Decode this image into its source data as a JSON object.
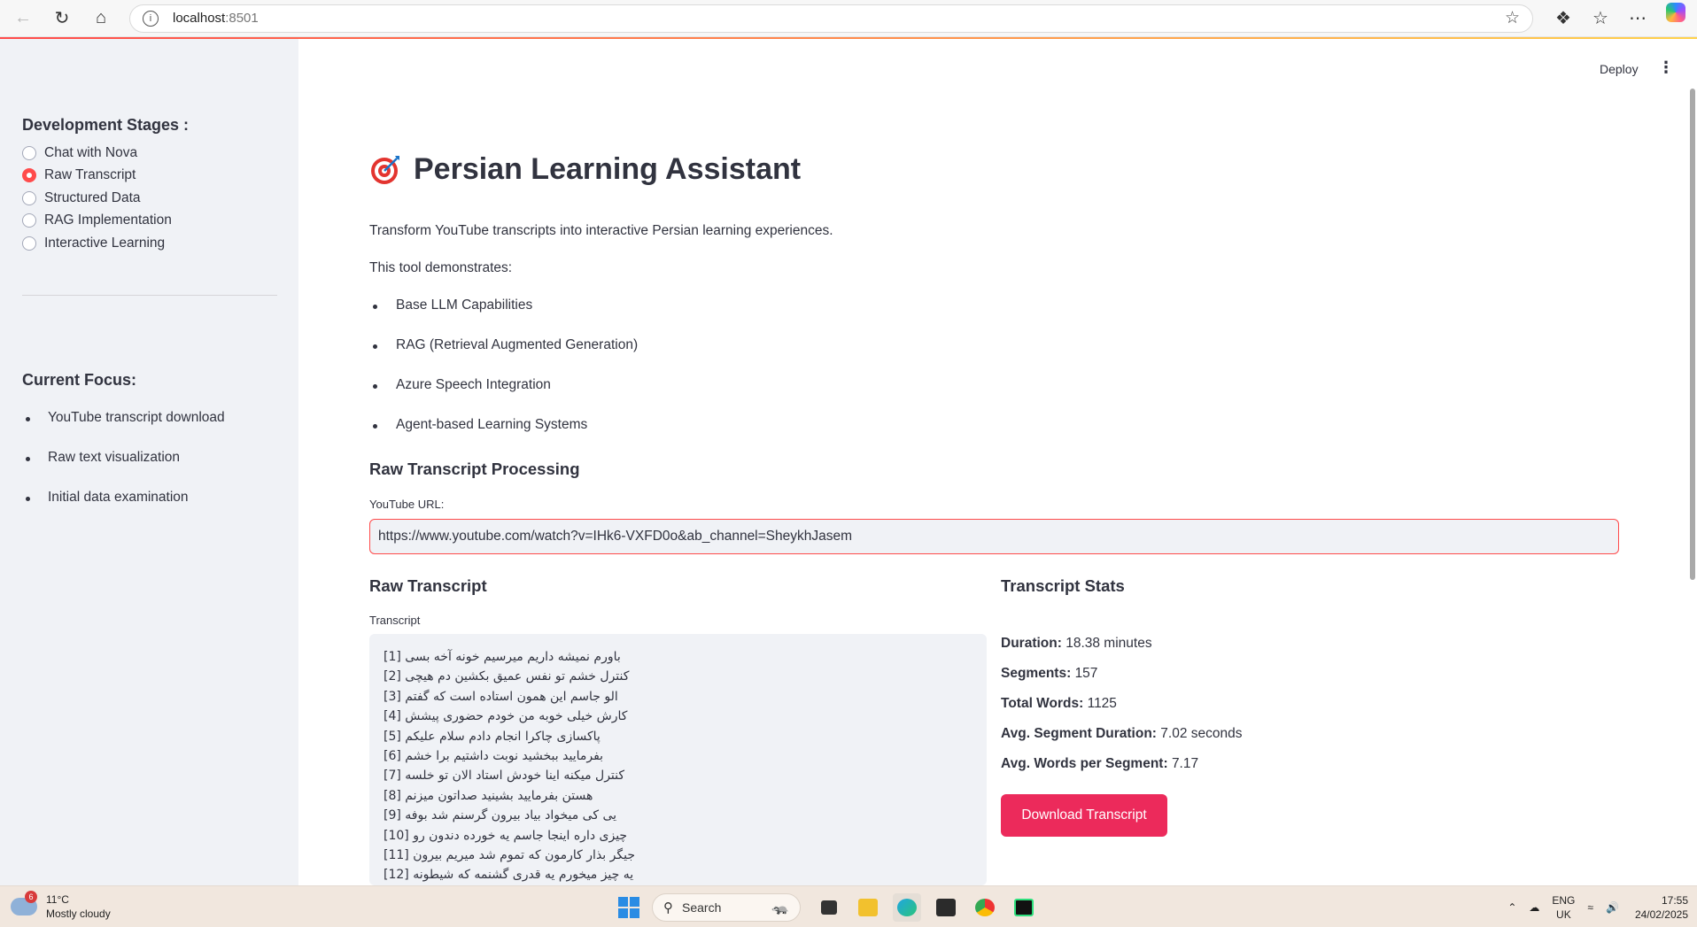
{
  "browser": {
    "url_host": "localhost",
    "url_port": ":8501"
  },
  "app": {
    "deploy_label": "Deploy",
    "title": "Persian Learning Assistant",
    "intro": "Transform YouTube transcripts into interactive Persian learning experiences.",
    "demonstrates": "This tool demonstrates:",
    "features": [
      "Base LLM Capabilities",
      "RAG (Retrieval Augmented Generation)",
      "Azure Speech Integration",
      "Agent-based Learning Systems"
    ]
  },
  "sidebar": {
    "stages_heading": "Development Stages :",
    "stages": [
      {
        "label": "Chat with Nova",
        "selected": false
      },
      {
        "label": "Raw Transcript",
        "selected": true
      },
      {
        "label": "Structured Data",
        "selected": false
      },
      {
        "label": "RAG Implementation",
        "selected": false
      },
      {
        "label": "Interactive Learning",
        "selected": false
      }
    ],
    "focus_heading": "Current Focus:",
    "focus_items": [
      "YouTube transcript download",
      "Raw text visualization",
      "Initial data examination"
    ]
  },
  "processing": {
    "heading": "Raw Transcript Processing",
    "url_label": "YouTube URL:",
    "url_value": "https://www.youtube.com/watch?v=IHk6-VXFD0o&ab_channel=SheykhJasem"
  },
  "transcript": {
    "heading": "Raw Transcript",
    "label": "Transcript",
    "lines": [
      "[1] باورم نمیشه داریم میرسیم خونه آخه بسی",
      "[2] کنترل خشم تو نفس عمیق بکشین دم هیچی",
      "[3] الو جاسم این همون استاده است که گفتم",
      "[4] کارش خیلی خوبه من خودم حضوری پیشش",
      "[5] پاکسازی چاکرا انجام دادم سلام علیکم",
      "[6] بفرمایید ببخشید نوبت داشتیم برا خشم",
      "[7] کنترل میکنه اینا خودش استاد الان تو خلسه",
      "[8] هستن بفرمایید بشینید صداتون میزنم",
      "[9] یی کی میخواد بیاد بیرون گرسنم شد بوفه",
      "[10] چیزی داره اینجا جاسم یه خورده دندون رو",
      "[11] جیگر بذار کارمون که تموم شد میریم بیرون",
      "[12] یه چیز میخورم یه قدری گشنمه که شیطونه"
    ]
  },
  "stats": {
    "heading": "Transcript Stats",
    "items": [
      {
        "label": "Duration:",
        "value": "18.38 minutes"
      },
      {
        "label": "Segments:",
        "value": "157"
      },
      {
        "label": "Total Words:",
        "value": "1125"
      },
      {
        "label": "Avg. Segment Duration:",
        "value": "7.02 seconds"
      },
      {
        "label": "Avg. Words per Segment:",
        "value": "7.17"
      }
    ],
    "download_label": "Download Transcript"
  },
  "taskbar": {
    "temperature": "11°C",
    "weather": "Mostly cloudy",
    "weather_badge": "6",
    "search_placeholder": "Search",
    "lang_top": "ENG",
    "lang_bottom": "UK",
    "time": "17:55",
    "date": "24/02/2025"
  },
  "colors": {
    "accent": "#ff4b4b",
    "button": "#ec2a5b",
    "sidebar_bg": "#f0f2f6"
  }
}
